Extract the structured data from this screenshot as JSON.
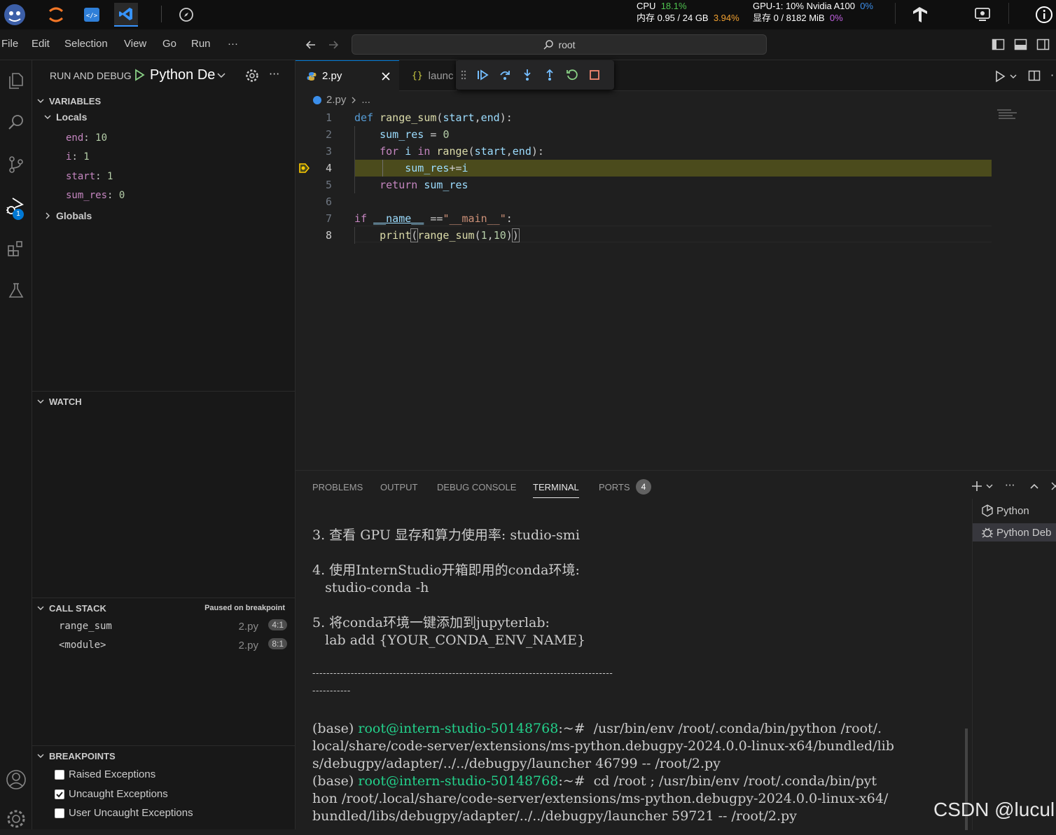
{
  "system": {
    "cpu_label": "CPU",
    "cpu_value": "18.1%",
    "mem_label": "内存 0.95 / 24 GB",
    "mem_value": "3.94%",
    "gpu_label": "GPU-1: 10% Nvidia A100",
    "gpu_value": "0%",
    "vram_label": "显存 0 / 8182 MiB",
    "vram_value": "0%"
  },
  "menu": [
    "File",
    "Edit",
    "Selection",
    "View",
    "Go",
    "Run",
    "···"
  ],
  "command_center": "root",
  "sidebar": {
    "title": "RUN AND DEBUG",
    "config": "Python De",
    "variables_header": "VARIABLES",
    "locals_header": "Locals",
    "locals": [
      {
        "name": "end",
        "value": "10"
      },
      {
        "name": "i",
        "value": "1"
      },
      {
        "name": "start",
        "value": "1"
      },
      {
        "name": "sum_res",
        "value": "0"
      }
    ],
    "globals_header": "Globals",
    "watch_header": "WATCH",
    "callstack_header": "CALL STACK",
    "callstack_status": "Paused on breakpoint",
    "frames": [
      {
        "name": "range_sum",
        "file": "2.py",
        "pos": "4:1"
      },
      {
        "name": "<module>",
        "file": "2.py",
        "pos": "8:1"
      }
    ],
    "breakpoints_header": "BREAKPOINTS",
    "breakpoints": [
      {
        "label": "Raised Exceptions",
        "checked": false
      },
      {
        "label": "Uncaught Exceptions",
        "checked": true
      },
      {
        "label": "User Uncaught Exceptions",
        "checked": false
      }
    ],
    "debug_badge": "1"
  },
  "editor": {
    "tab1": "2.py",
    "tab2": "launc",
    "breadcrumb_file": "2.py",
    "breadcrumb_rest": "...",
    "line_numbers": [
      "1",
      "2",
      "3",
      "4",
      "5",
      "6",
      "7",
      "8"
    ]
  },
  "panel": {
    "tabs": [
      "PROBLEMS",
      "OUTPUT",
      "DEBUG CONSOLE",
      "TERMINAL",
      "PORTS"
    ],
    "ports_count": "4",
    "terminals": [
      "Python",
      "Python Deb"
    ],
    "lines": {
      "l1": "3. 查看 GPU 显存和算力使用率: studio-smi",
      "l2": "4. 使用InternStudio开箱即用的conda环境:",
      "l3": "   studio-conda -h",
      "l4": "5. 将conda环境一键添加到jupyterlab:",
      "l5": "   lab add {YOUR_CONDA_ENV_NAME}",
      "sep1": "--------------------------------------------------------------------------------------",
      "sep2": "-----------",
      "p1_prefix": "(base) ",
      "p1_user": "root@intern-studio-50148768",
      "p1_rest": ":~#  /usr/bin/env /root/.conda/bin/python /root/.",
      "p1_l2": "local/share/code-server/extensions/ms-python.debugpy-2024.0.0-linux-x64/bundled/lib",
      "p1_l3": "s/debugpy/adapter/../../debugpy/launcher 46799 -- /root/2.py",
      "p2_prefix": "(base) ",
      "p2_user": "root@intern-studio-50148768",
      "p2_rest": ":~#  cd /root ; /usr/bin/env /root/.conda/bin/pyt",
      "p2_l2": "hon /root/.local/share/code-server/extensions/ms-python.debugpy-2024.0.0-linux-x64/",
      "p2_l3": "bundled/libs/debugpy/adapter/../../debugpy/launcher 59721 -- /root/2.py"
    }
  },
  "watermark": "CSDN @lucul"
}
